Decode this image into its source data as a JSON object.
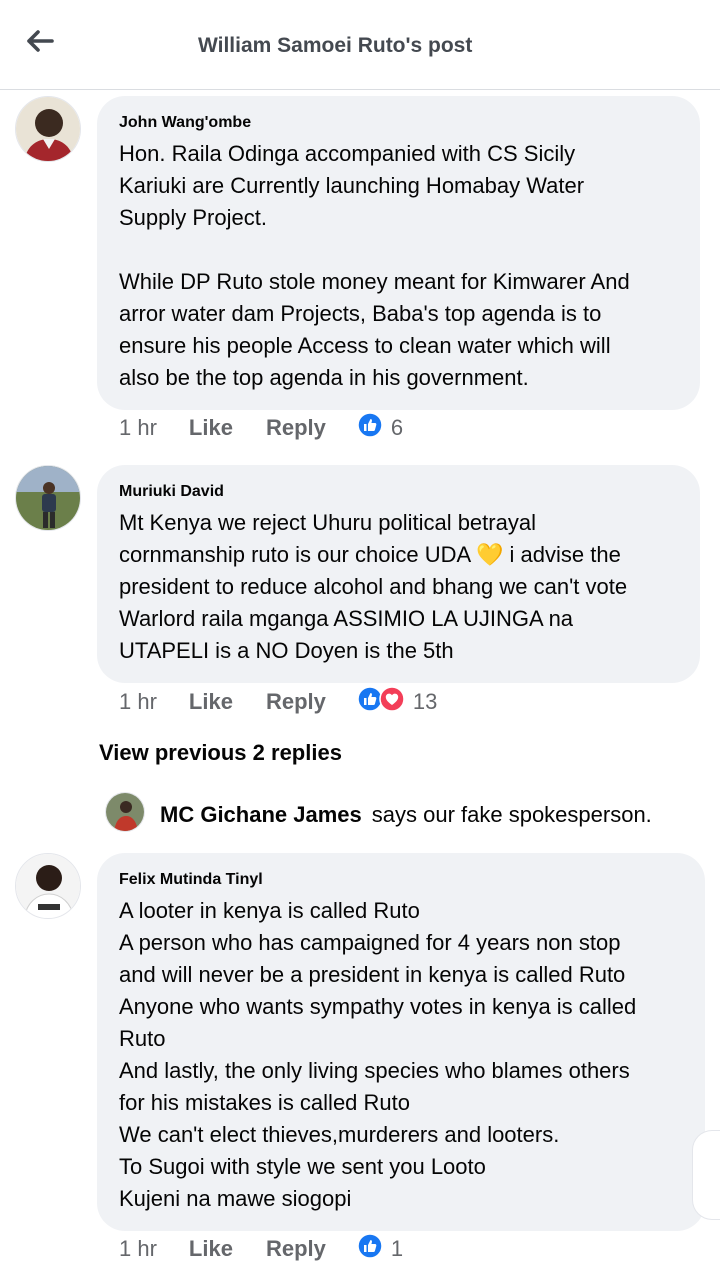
{
  "header": {
    "title": "William Samoei Ruto's post",
    "back_icon": "arrow-left-icon"
  },
  "comments": [
    {
      "author": "John Wang'ombe",
      "lines": [
        "Hon. Raila Odinga accompanied with CS Sicily",
        "Kariuki are Currently launching Homabay Water",
        "Supply Project.",
        "",
        "While DP Ruto stole money meant for Kimwarer And",
        "arror water dam Projects, Baba's top agenda is to",
        "ensure his people Access to clean water which will",
        "also be the top agenda in his government."
      ],
      "time": "1 hr",
      "like_label": "Like",
      "reply_label": "Reply",
      "reactions": [
        "like"
      ],
      "reaction_count": "6"
    },
    {
      "author": "Muriuki David",
      "lines": [
        "Mt Kenya we reject Uhuru political betrayal",
        "cornmanship ruto is our choice UDA 💛 i advise the",
        "president to reduce alcohol and bhang we can't vote",
        "Warlord raila mganga ASSIMIO LA UJINGA na",
        "UTAPELI is a NO Doyen is the 5th"
      ],
      "time": "1 hr",
      "like_label": "Like",
      "reply_label": "Reply",
      "reactions": [
        "like",
        "love"
      ],
      "reaction_count": "13"
    },
    {
      "author": "Felix Mutinda Tinyl",
      "lines": [
        "A looter in kenya is called Ruto",
        "A person who has campaigned for 4 years non stop",
        "and will never be a president in kenya is called Ruto",
        "Anyone who wants sympathy votes in kenya is called",
        "Ruto",
        "And lastly, the only living species who blames others",
        "for his mistakes is called Ruto",
        "We can't elect thieves,murderers and looters.",
        "To Sugoi with style we sent you Looto",
        "Kujeni na mawe siogopi"
      ],
      "time": "1 hr",
      "like_label": "Like",
      "reply_label": "Reply",
      "reactions": [
        "like"
      ],
      "reaction_count": "1"
    }
  ],
  "view_previous": "View previous 2 replies",
  "latest_reply": {
    "author": "MC Gichane James",
    "text": "says our fake spokesperson."
  },
  "colors": {
    "like_blue": "#1877f2",
    "love_red": "#f33e58",
    "bubble_gray": "#f0f2f5",
    "meta_gray": "#65676b"
  }
}
